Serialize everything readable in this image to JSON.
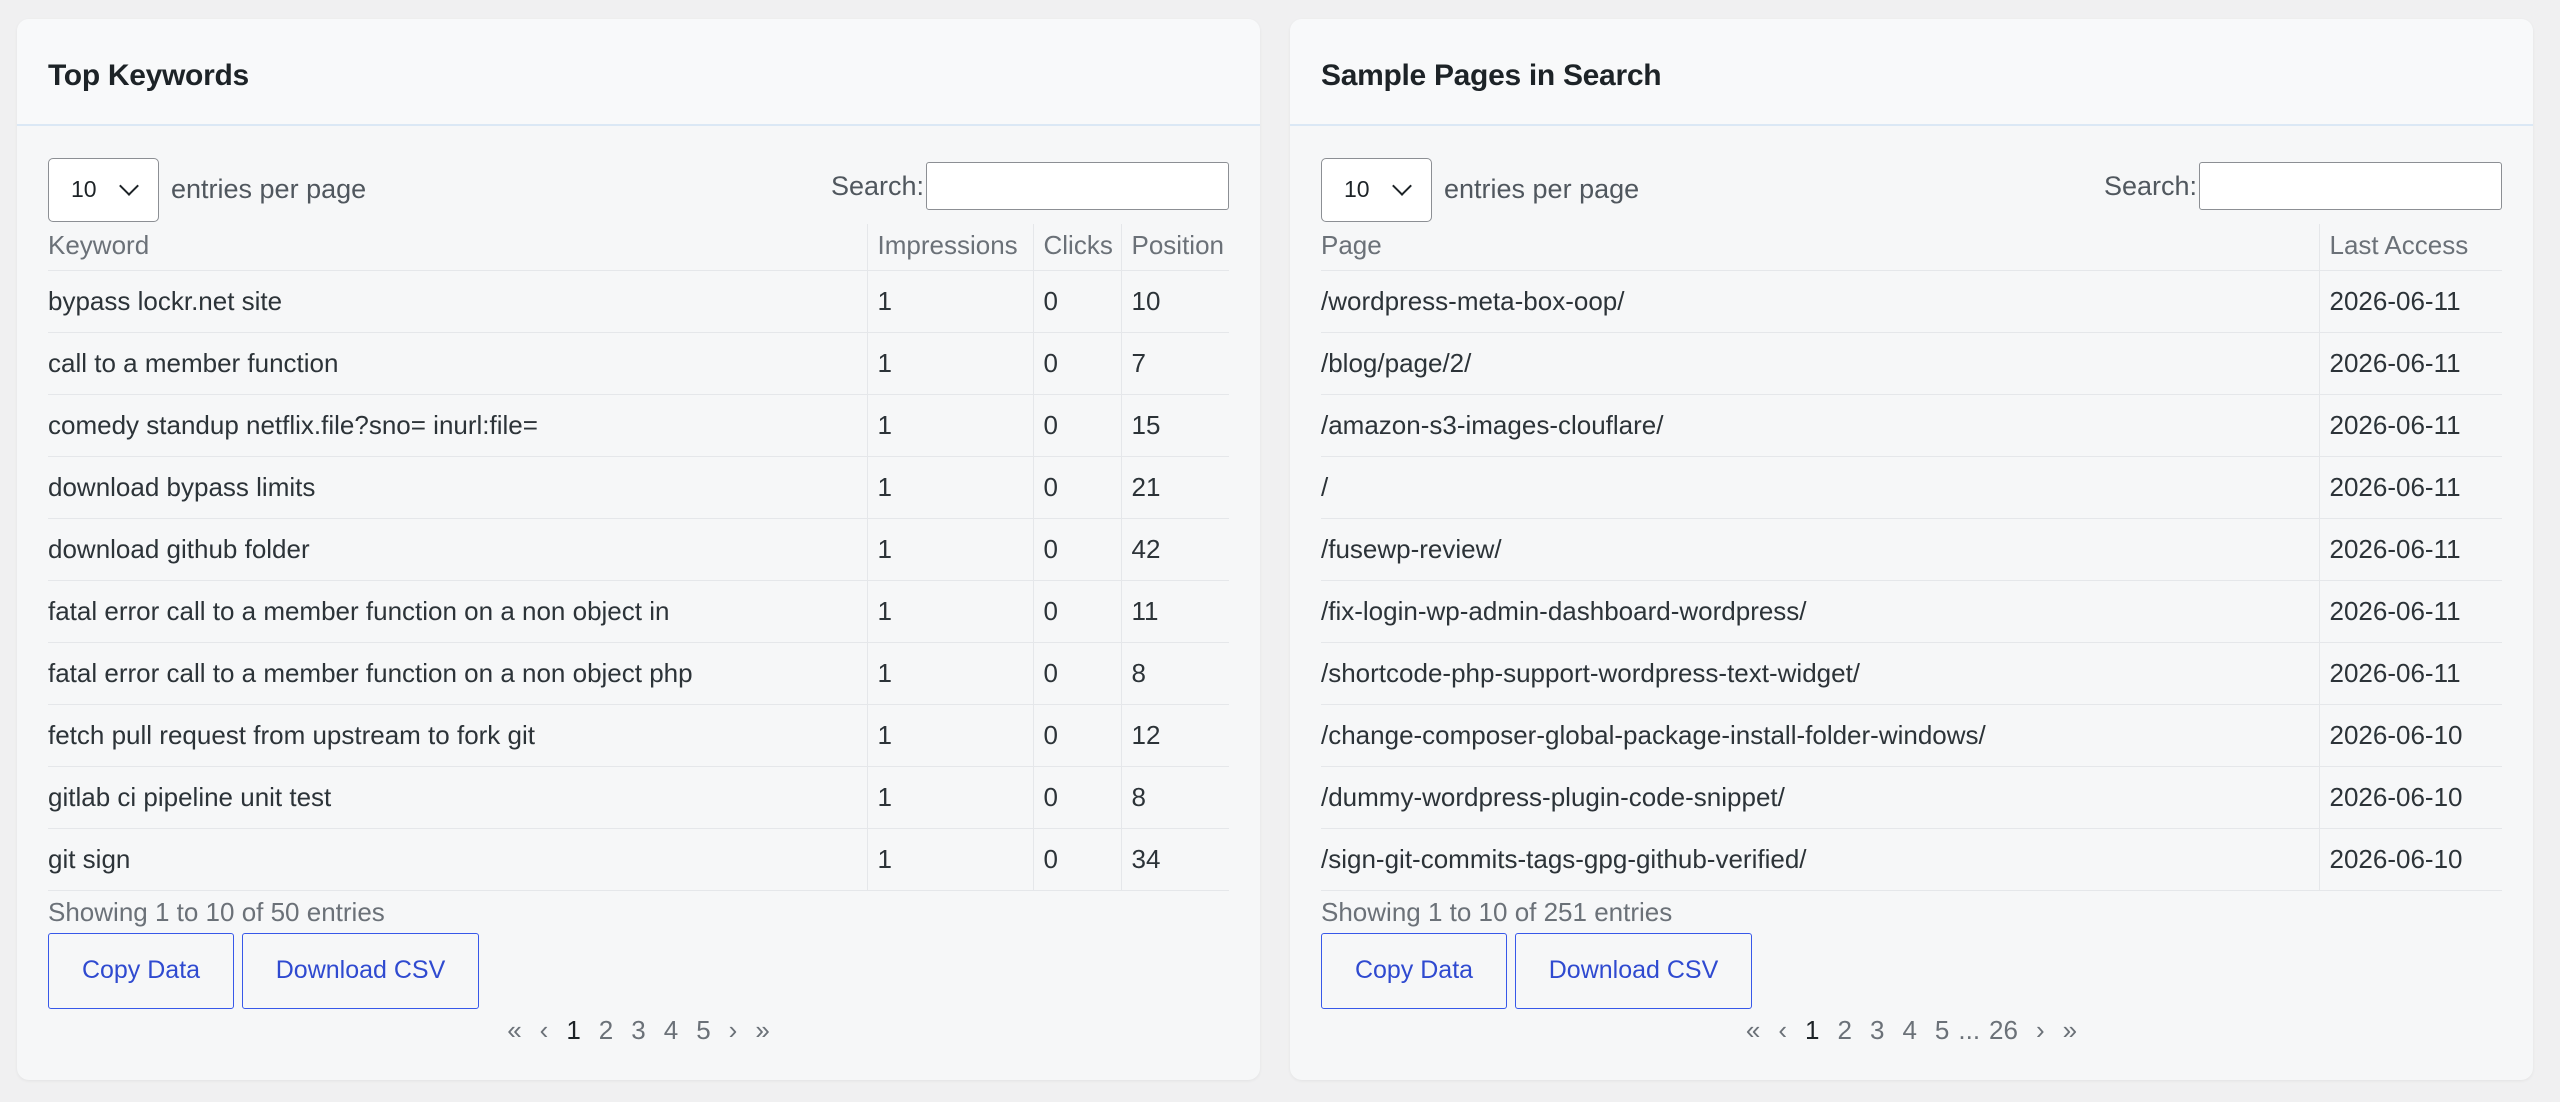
{
  "left_panel": {
    "title": "Top Keywords",
    "length_value": "10",
    "length_label": "entries per page",
    "search_label": "Search:",
    "columns": [
      "Keyword",
      "Impressions",
      "Clicks",
      "Position"
    ],
    "rows": [
      [
        "bypass lockr.net site",
        "1",
        "0",
        "10"
      ],
      [
        "call to a member function",
        "1",
        "0",
        "7"
      ],
      [
        "comedy standup netflix.file?sno= inurl:file=",
        "1",
        "0",
        "15"
      ],
      [
        "download bypass limits",
        "1",
        "0",
        "21"
      ],
      [
        "download github folder",
        "1",
        "0",
        "42"
      ],
      [
        "fatal error call to a member function on a non object in",
        "1",
        "0",
        "11"
      ],
      [
        "fatal error call to a member function on a non object php",
        "1",
        "0",
        "8"
      ],
      [
        "fetch pull request from upstream to fork git",
        "1",
        "0",
        "12"
      ],
      [
        "gitlab ci pipeline unit test",
        "1",
        "0",
        "8"
      ],
      [
        "git sign",
        "1",
        "0",
        "34"
      ]
    ],
    "info": "Showing 1 to 10 of 50 entries",
    "copy_label": "Copy Data",
    "csv_label": "Download CSV",
    "pager": [
      "«",
      "‹",
      "1",
      "2",
      "3",
      "4",
      "5",
      "›",
      "»"
    ]
  },
  "right_panel": {
    "title": "Sample Pages in Search",
    "length_value": "10",
    "length_label": "entries per page",
    "search_label": "Search:",
    "columns": [
      "Page",
      "Last Access"
    ],
    "rows": [
      [
        "/wordpress-meta-box-oop/",
        "2026-06-11"
      ],
      [
        "/blog/page/2/",
        "2026-06-11"
      ],
      [
        "/amazon-s3-images-clouflare/",
        "2026-06-11"
      ],
      [
        "/",
        "2026-06-11"
      ],
      [
        "/fusewp-review/",
        "2026-06-11"
      ],
      [
        "/fix-login-wp-admin-dashboard-wordpress/",
        "2026-06-11"
      ],
      [
        "/shortcode-php-support-wordpress-text-widget/",
        "2026-06-11"
      ],
      [
        "/change-composer-global-package-install-folder-windows/",
        "2026-06-10"
      ],
      [
        "/dummy-wordpress-plugin-code-snippet/",
        "2026-06-10"
      ],
      [
        "/sign-git-commits-tags-gpg-github-verified/",
        "2026-06-10"
      ]
    ],
    "info": "Showing 1 to 10 of 251 entries",
    "copy_label": "Copy Data",
    "csv_label": "Download CSV",
    "pager": [
      "«",
      "‹",
      "1",
      "2",
      "3",
      "4",
      "5",
      "...",
      "26",
      "›",
      "»"
    ]
  },
  "colors": {
    "accent": "#3858e9",
    "background": "#f0f0f1",
    "panel": "#f6f7f8"
  }
}
